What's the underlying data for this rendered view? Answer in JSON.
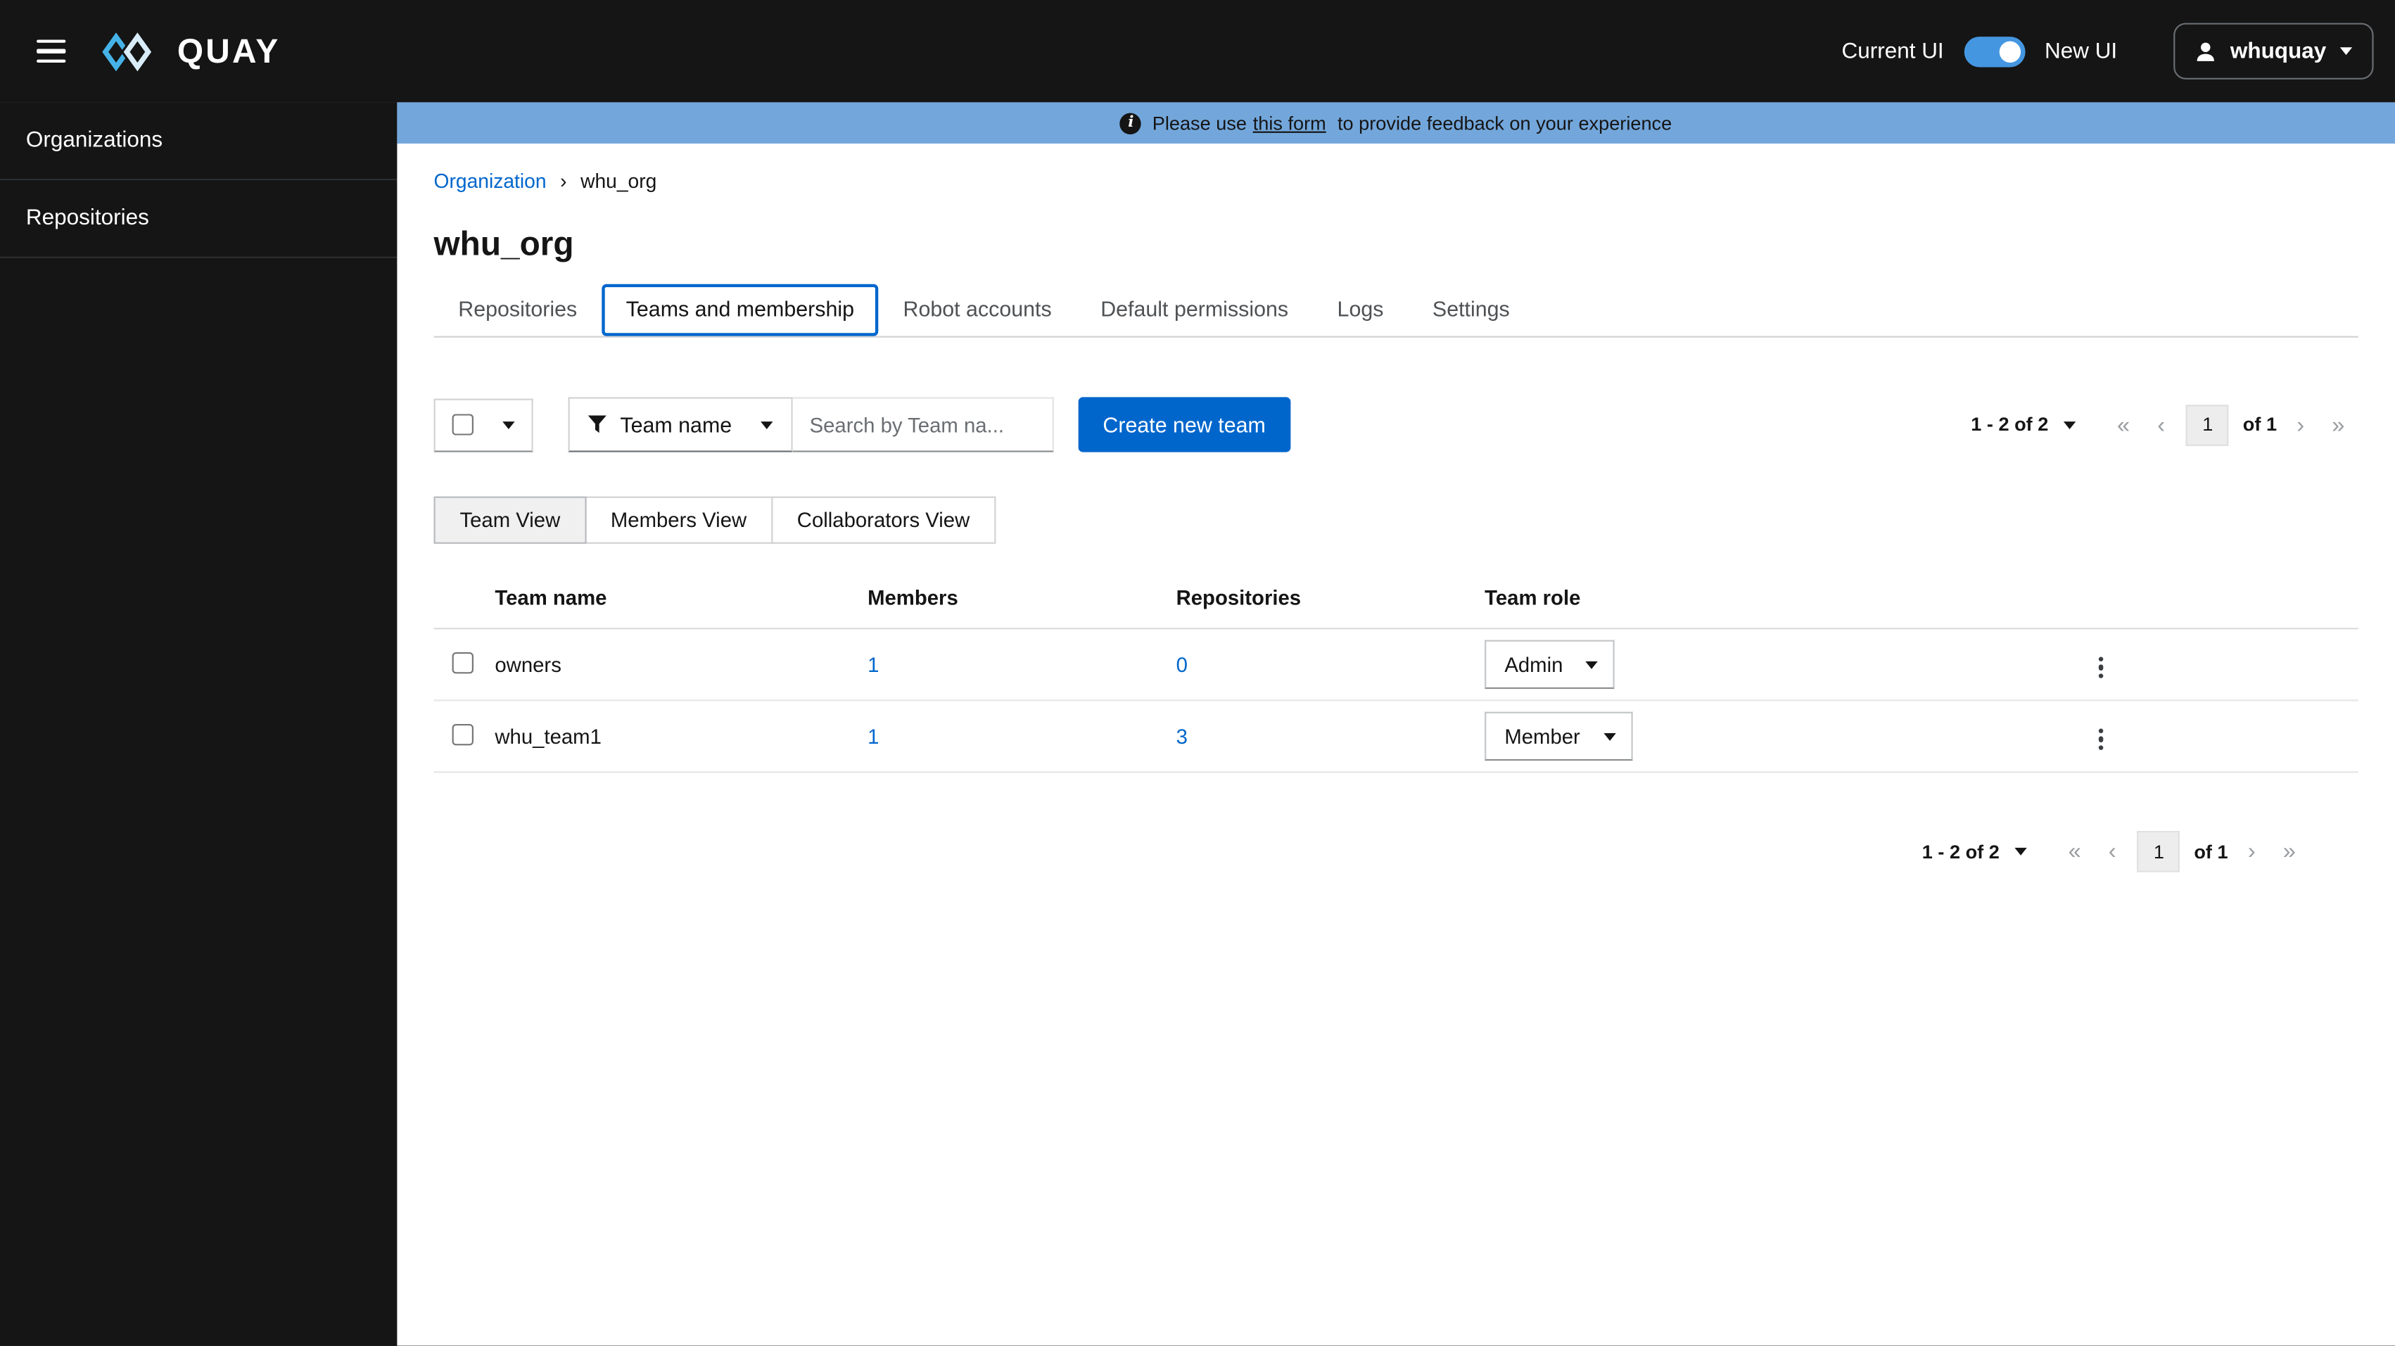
{
  "colors": {
    "masthead_bg": "#151515",
    "primary_blue": "#0066cc",
    "banner_info_bg": "#73a7dc",
    "link_blue": "#0066cc",
    "switch_on_blue": "#4596e0"
  },
  "topbar": {
    "brand": "QUAY",
    "ui_toggle": {
      "left_label": "Current UI",
      "right_label": "New UI",
      "state": "on"
    },
    "user_menu": {
      "username": "whuquay"
    }
  },
  "sidebar": {
    "items": [
      {
        "label": "Organizations"
      },
      {
        "label": "Repositories"
      }
    ]
  },
  "banner": {
    "prefix": "Please use",
    "link_text": "this form",
    "suffix": "to provide feedback on your experience"
  },
  "breadcrumb": {
    "items": [
      {
        "label": "Organization"
      }
    ],
    "current": "whu_org"
  },
  "page": {
    "title": "whu_org"
  },
  "tabs": [
    {
      "label": "Repositories"
    },
    {
      "label": "Teams and membership",
      "active": true
    },
    {
      "label": "Robot accounts"
    },
    {
      "label": "Default permissions"
    },
    {
      "label": "Logs"
    },
    {
      "label": "Settings"
    }
  ],
  "toolbar": {
    "filter": {
      "label": "Team name"
    },
    "search": {
      "placeholder": "Search by Team na..."
    },
    "create_button_label": "Create new team",
    "pagination": {
      "range": "1 - 2 of 2",
      "current_page": "1",
      "total_pages": "of 1"
    }
  },
  "view_toggle": {
    "options": [
      {
        "label": "Team View",
        "selected": true
      },
      {
        "label": "Members View",
        "selected": false
      },
      {
        "label": "Collaborators View",
        "selected": false
      }
    ]
  },
  "table": {
    "headers": [
      "Team name",
      "Members",
      "Repositories",
      "Team role"
    ],
    "rows": [
      {
        "name": "owners",
        "members": "1",
        "repositories": "0",
        "role": "Admin"
      },
      {
        "name": "whu_team1",
        "members": "1",
        "repositories": "3",
        "role": "Member"
      }
    ]
  },
  "bottom_pagination": {
    "range": "1 - 2 of 2",
    "current_page": "1",
    "total_pages": "of 1"
  },
  "icons": {
    "info": "i",
    "breadcrumb_chevron": "›",
    "pagination_first": "«",
    "pagination_prev": "‹",
    "pagination_next": "›",
    "pagination_last": "»"
  }
}
